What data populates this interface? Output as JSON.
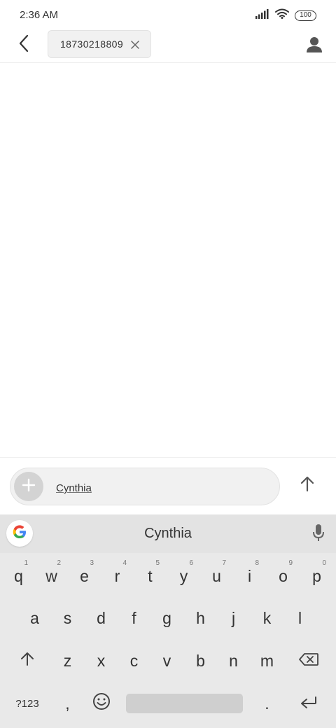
{
  "status_bar": {
    "time": "2:36 AM",
    "battery": "100",
    "icons": [
      "signal-icon",
      "wifi-icon",
      "battery-icon"
    ]
  },
  "header": {
    "back_icon": "chevron-left-icon",
    "recipient": "18730218809",
    "recipient_remove_icon": "close-icon",
    "contact_icon": "person-icon"
  },
  "compose": {
    "attach_icon": "plus-icon",
    "text": "Cynthia",
    "send_icon": "arrow-up-icon"
  },
  "keyboard": {
    "google_icon": "google-g-icon",
    "suggestion": "Cynthia",
    "mic_icon": "microphone-icon",
    "row1": [
      {
        "key": "q",
        "hint": "1"
      },
      {
        "key": "w",
        "hint": "2"
      },
      {
        "key": "e",
        "hint": "3"
      },
      {
        "key": "r",
        "hint": "4"
      },
      {
        "key": "t",
        "hint": "5"
      },
      {
        "key": "y",
        "hint": "6"
      },
      {
        "key": "u",
        "hint": "7"
      },
      {
        "key": "i",
        "hint": "8"
      },
      {
        "key": "o",
        "hint": "9"
      },
      {
        "key": "p",
        "hint": "0"
      }
    ],
    "row2": [
      "a",
      "s",
      "d",
      "f",
      "g",
      "h",
      "j",
      "k",
      "l"
    ],
    "row3": [
      "z",
      "x",
      "c",
      "v",
      "b",
      "n",
      "m"
    ],
    "symbols_key": "?123",
    "comma_key": ",",
    "period_key": ".",
    "shift_icon": "shift-icon",
    "backspace_icon": "backspace-icon",
    "emoji_icon": "emoji-icon",
    "enter_icon": "enter-icon"
  }
}
